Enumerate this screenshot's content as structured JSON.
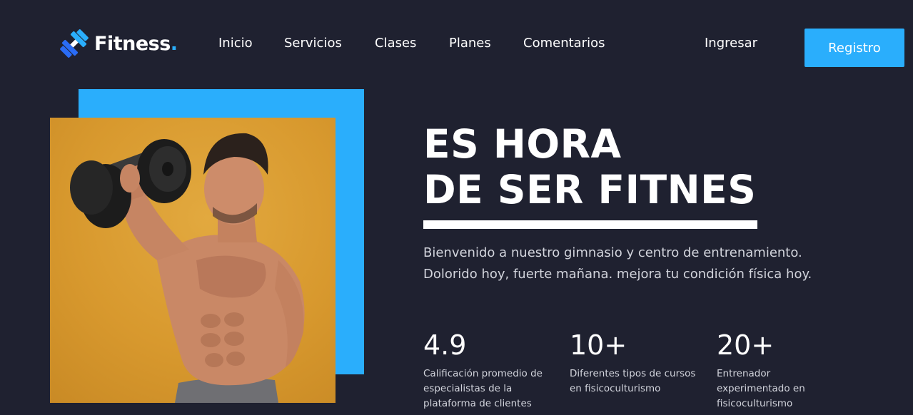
{
  "brand": {
    "name": "Fitness",
    "dot": ".",
    "accent_color": "#2aaefc",
    "background_color": "#1f2130",
    "logo_icon": "dumbbell-icon"
  },
  "nav": {
    "items": [
      {
        "label": "Inicio"
      },
      {
        "label": "Servicios"
      },
      {
        "label": "Clases"
      },
      {
        "label": "Planes"
      },
      {
        "label": "Comentarios"
      }
    ],
    "login_label": "Ingresar",
    "register_label": "Registro"
  },
  "hero": {
    "title_line1": "ES HORA",
    "title_line2": "DE SER FITNES",
    "description_line1": "Bienvenido a nuestro gimnasio y centro de entrenamiento.",
    "description_line2": "Dolorido hoy, fuerte mañana. mejora tu condición física hoy."
  },
  "stats": [
    {
      "value": "4.9",
      "label": "Calificación promedio de especialistas de la plataforma de clientes"
    },
    {
      "value": "10+",
      "label": "Diferentes tipos de cursos en fisicoculturismo"
    },
    {
      "value": "20+",
      "label": "Entrenador experimentado en fisicoculturismo"
    }
  ]
}
